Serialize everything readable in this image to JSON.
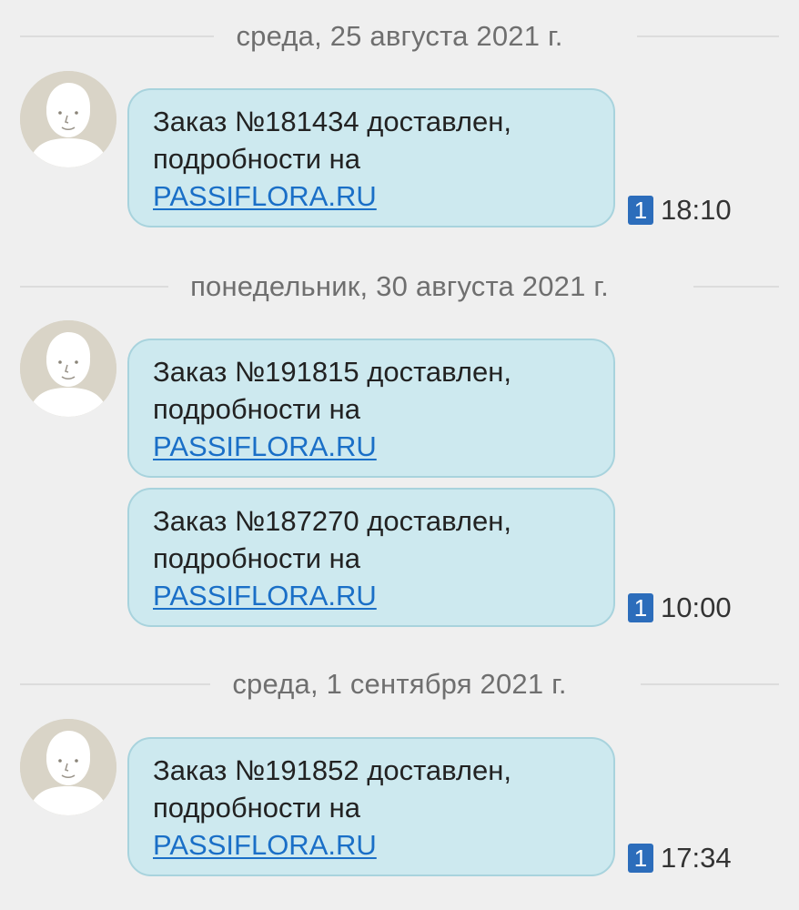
{
  "groups": [
    {
      "date": "среда, 25 августа 2021 г.",
      "messages": [
        {
          "line1": "Заказ №181434 доставлен,",
          "line2": "подробности на",
          "link": "PASSIFLORA.RU",
          "sim": "1",
          "time": "18:10"
        }
      ]
    },
    {
      "date": "понедельник, 30 августа 2021 г.",
      "messages": [
        {
          "line1": "Заказ №191815 доставлен,",
          "line2": "подробности на",
          "link": "PASSIFLORA.RU"
        },
        {
          "line1": "Заказ №187270 доставлен,",
          "line2": "подробности на",
          "link": "PASSIFLORA.RU",
          "sim": "1",
          "time": "10:00"
        }
      ]
    },
    {
      "date": "среда, 1 сентября 2021 г.",
      "messages": [
        {
          "line1": "Заказ №191852 доставлен,",
          "line2": "подробности на",
          "link": "PASSIFLORA.RU",
          "sim": "1",
          "time": "17:34"
        }
      ]
    }
  ],
  "colors": {
    "background": "#efefef",
    "bubble": "#cde9ef",
    "link": "#1a6fc7",
    "sim_badge": "#2c6dbb"
  },
  "icons": {
    "avatar": "default-person-avatar-icon",
    "sim": "sim-1-badge-icon"
  }
}
